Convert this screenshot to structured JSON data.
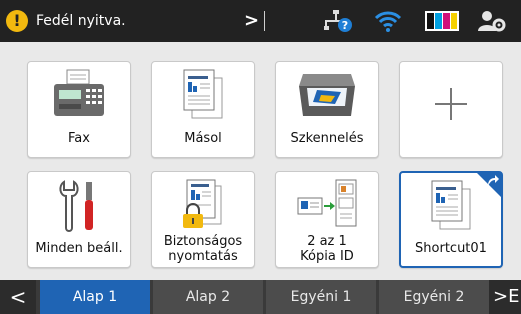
{
  "status": {
    "message": "Fedél nyitva.",
    "warning_symbol": "!",
    "chevron": ">",
    "icons": [
      "warning-icon",
      "network-icon",
      "wifi-icon",
      "ink-icon",
      "admin-icon"
    ]
  },
  "colors": {
    "top_bar": "#222222",
    "background": "#e9e9e9",
    "accent": "#1f64b4",
    "warning": "#f2b90f",
    "tab": "#4c4c4c",
    "ink_cyan": "#00a0e0",
    "ink_magenta": "#d0107a",
    "ink_yellow": "#f6d000",
    "ink_black": "#111111"
  },
  "tiles": [
    {
      "label": "Fax",
      "icon": "fax-icon"
    },
    {
      "label": "Másol",
      "icon": "copy-icon"
    },
    {
      "label": "Szkennelés",
      "icon": "scanner-icon"
    },
    {
      "label": "",
      "icon": "plus-icon"
    },
    {
      "label": "Minden beáll.",
      "icon": "tools-icon"
    },
    {
      "label_line1": "Biztonságos",
      "label_line2": "nyomtatás",
      "icon": "secure-print-icon"
    },
    {
      "label_line1": "2 az 1",
      "label_line2": "Kópia ID",
      "icon": "id-copy-icon"
    },
    {
      "label": "Shortcut01",
      "icon": "shortcut-doc-icon",
      "selected": true
    }
  ],
  "tabs": {
    "left_arrow": "<",
    "right_arrow": ">E",
    "items": [
      {
        "label": "Alap 1",
        "active": true
      },
      {
        "label": "Alap 2",
        "active": false
      },
      {
        "label": "Egyéni 1",
        "active": false
      },
      {
        "label": "Egyéni 2",
        "active": false
      }
    ]
  }
}
